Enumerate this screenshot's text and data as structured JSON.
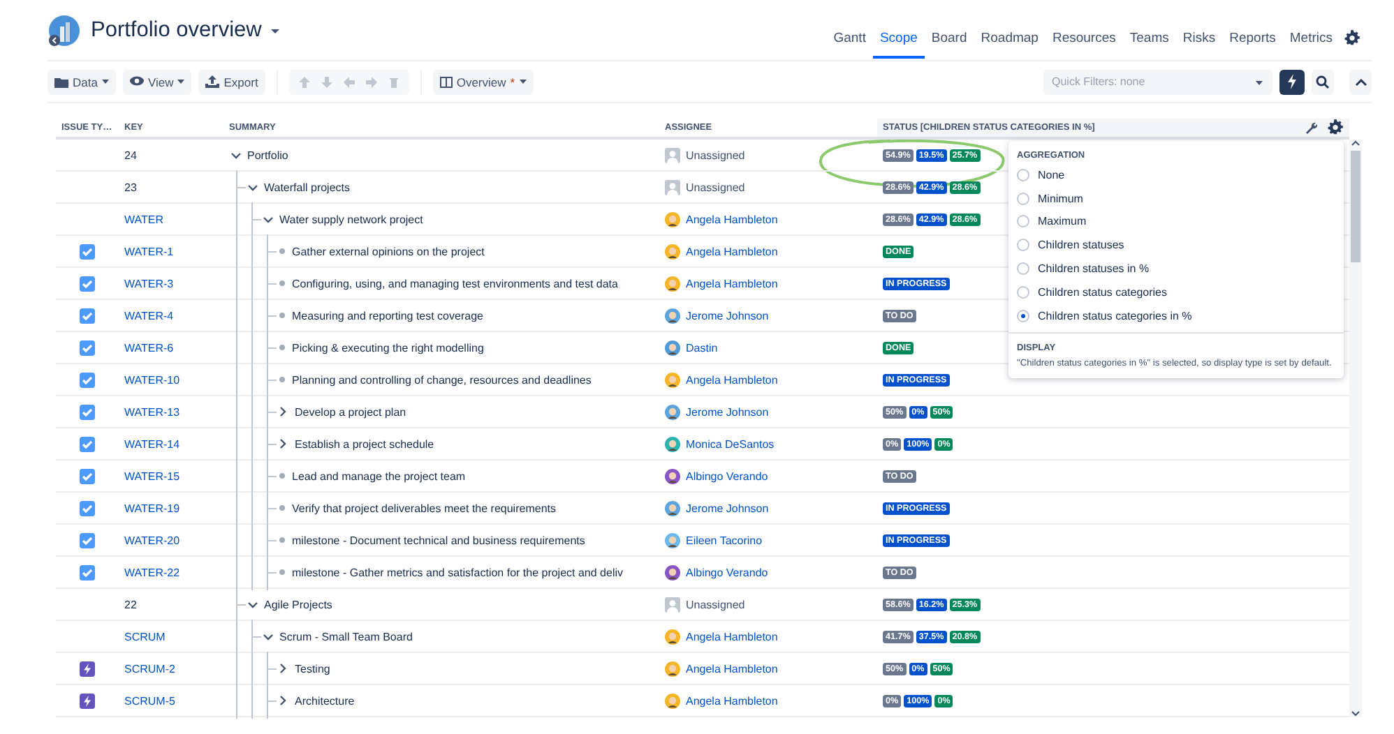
{
  "header": {
    "title": "Portfolio overview",
    "tabs": [
      {
        "label": "Gantt",
        "selected": false
      },
      {
        "label": "Scope",
        "selected": true
      },
      {
        "label": "Board",
        "selected": false
      },
      {
        "label": "Roadmap",
        "selected": false
      },
      {
        "label": "Resources",
        "selected": false
      },
      {
        "label": "Teams",
        "selected": false
      },
      {
        "label": "Risks",
        "selected": false
      },
      {
        "label": "Reports",
        "selected": false
      },
      {
        "label": "Metrics",
        "selected": false
      }
    ]
  },
  "toolbar": {
    "buttons": [
      {
        "label": "Data",
        "kind": "menu"
      },
      {
        "label": "View",
        "kind": "menu"
      },
      {
        "label": "Export",
        "kind": "action"
      }
    ],
    "view": {
      "label": "Overview",
      "modified_mark": "*"
    },
    "quick_filters": {
      "placeholder": "Quick Filters: none"
    }
  },
  "table": {
    "columns": [
      "ISSUE TY…",
      "KEY",
      "SUMMARY",
      "ASSIGNEE",
      "STATUS [CHILDREN STATUS CATEGORIES IN %]"
    ],
    "rows": [
      {
        "key": "24",
        "key_link": false,
        "summary": "Portfolio",
        "expanded": true,
        "assignee": {
          "name": "Unassigned",
          "unassigned": true
        },
        "status": [
          {
            "text": "54.9%",
            "kind": "todo"
          },
          {
            "text": "19.5%",
            "kind": "inprogress"
          },
          {
            "text": "25.7%",
            "kind": "done"
          }
        ],
        "children": [
          {
            "key": "23",
            "key_link": false,
            "summary": "Waterfall projects",
            "expanded": true,
            "assignee": {
              "name": "Unassigned",
              "unassigned": true
            },
            "status": [
              {
                "text": "28.6%",
                "kind": "todo"
              },
              {
                "text": "42.9%",
                "kind": "inprogress"
              },
              {
                "text": "28.6%",
                "kind": "done"
              }
            ],
            "children": [
              {
                "key": "WATER",
                "key_link": true,
                "summary": "Water supply network project",
                "expanded": true,
                "assignee": {
                  "name": "Angela Hambleton",
                  "unassigned": false,
                  "color": "#f4b526"
                },
                "status": [
                  {
                    "text": "28.6%",
                    "kind": "todo"
                  },
                  {
                    "text": "42.9%",
                    "kind": "inprogress"
                  },
                  {
                    "text": "28.6%",
                    "kind": "done"
                  }
                ],
                "children": [
                  {
                    "kind": "task",
                    "key": "WATER-1",
                    "key_link": true,
                    "summary": "Gather external opinions on the project",
                    "assignee": {
                      "name": "Angela Hambleton",
                      "unassigned": false,
                      "color": "#f4b526"
                    },
                    "status": [
                      {
                        "text": "DONE",
                        "kind": "done"
                      }
                    ]
                  },
                  {
                    "kind": "task",
                    "key": "WATER-3",
                    "key_link": true,
                    "summary": "Configuring, using, and managing test environments and test data",
                    "assignee": {
                      "name": "Angela Hambleton",
                      "unassigned": false,
                      "color": "#f4b526"
                    },
                    "status": [
                      {
                        "text": "IN PROGRESS",
                        "kind": "inprogress"
                      }
                    ]
                  },
                  {
                    "kind": "task",
                    "key": "WATER-4",
                    "key_link": true,
                    "summary": "Measuring and reporting test coverage",
                    "assignee": {
                      "name": "Jerome Johnson",
                      "unassigned": false,
                      "color": "#5ba4dd"
                    },
                    "status": [
                      {
                        "text": "TO DO",
                        "kind": "todo"
                      }
                    ]
                  },
                  {
                    "kind": "task",
                    "key": "WATER-6",
                    "key_link": true,
                    "summary": "Picking & executing the right modelling",
                    "assignee": {
                      "name": "Dastin",
                      "unassigned": false,
                      "color": "#4f9bd8"
                    },
                    "status": [
                      {
                        "text": "DONE",
                        "kind": "done"
                      }
                    ]
                  },
                  {
                    "kind": "task",
                    "key": "WATER-10",
                    "key_link": true,
                    "summary": "Planning and controlling of change, resources and deadlines",
                    "assignee": {
                      "name": "Angela Hambleton",
                      "unassigned": false,
                      "color": "#f4b526"
                    },
                    "status": [
                      {
                        "text": "IN PROGRESS",
                        "kind": "inprogress"
                      }
                    ]
                  },
                  {
                    "kind": "task",
                    "key": "WATER-13",
                    "key_link": true,
                    "summary": "Develop a project plan",
                    "expanded": false,
                    "assignee": {
                      "name": "Jerome Johnson",
                      "unassigned": false,
                      "color": "#5ba4dd"
                    },
                    "status": [
                      {
                        "text": "50%",
                        "kind": "todo"
                      },
                      {
                        "text": "0%",
                        "kind": "inprogress"
                      },
                      {
                        "text": "50%",
                        "kind": "done"
                      }
                    ]
                  },
                  {
                    "kind": "task",
                    "key": "WATER-14",
                    "key_link": true,
                    "summary": "Establish a project schedule",
                    "expanded": false,
                    "assignee": {
                      "name": "Monica DeSantos",
                      "unassigned": false,
                      "color": "#2bb5b0"
                    },
                    "status": [
                      {
                        "text": "0%",
                        "kind": "todo"
                      },
                      {
                        "text": "100%",
                        "kind": "inprogress"
                      },
                      {
                        "text": "0%",
                        "kind": "done"
                      }
                    ]
                  },
                  {
                    "kind": "task",
                    "key": "WATER-15",
                    "key_link": true,
                    "summary": "Lead and manage the project team",
                    "assignee": {
                      "name": "Albingo Verando",
                      "unassigned": false,
                      "color": "#8a55c4"
                    },
                    "status": [
                      {
                        "text": "TO DO",
                        "kind": "todo"
                      }
                    ]
                  },
                  {
                    "kind": "task",
                    "key": "WATER-19",
                    "key_link": true,
                    "summary": "Verify that project deliverables meet the requirements",
                    "assignee": {
                      "name": "Jerome Johnson",
                      "unassigned": false,
                      "color": "#5ba4dd"
                    },
                    "status": [
                      {
                        "text": "IN PROGRESS",
                        "kind": "inprogress"
                      }
                    ]
                  },
                  {
                    "kind": "task",
                    "key": "WATER-20",
                    "key_link": true,
                    "summary": "milestone - Document technical and business requirements",
                    "assignee": {
                      "name": "Eileen Tacorino",
                      "unassigned": false,
                      "color": "#6cb8e8"
                    },
                    "status": [
                      {
                        "text": "IN PROGRESS",
                        "kind": "inprogress"
                      }
                    ]
                  },
                  {
                    "kind": "task",
                    "key": "WATER-22",
                    "key_link": true,
                    "summary": "milestone - Gather metrics and satisfaction for the project and deliv",
                    "assignee": {
                      "name": "Albingo Verando",
                      "unassigned": false,
                      "color": "#8a55c4"
                    },
                    "status": [
                      {
                        "text": "TO DO",
                        "kind": "todo"
                      }
                    ]
                  }
                ]
              }
            ]
          },
          {
            "key": "22",
            "key_link": false,
            "summary": "Agile Projects",
            "expanded": true,
            "assignee": {
              "name": "Unassigned",
              "unassigned": true
            },
            "status": [
              {
                "text": "58.6%",
                "kind": "todo"
              },
              {
                "text": "16.2%",
                "kind": "inprogress"
              },
              {
                "text": "25.3%",
                "kind": "done"
              }
            ],
            "children": [
              {
                "key": "SCRUM",
                "key_link": true,
                "summary": "Scrum - Small Team Board",
                "expanded": true,
                "assignee": {
                  "name": "Angela Hambleton",
                  "unassigned": false,
                  "color": "#f4b526"
                },
                "status": [
                  {
                    "text": "41.7%",
                    "kind": "todo"
                  },
                  {
                    "text": "37.5%",
                    "kind": "inprogress"
                  },
                  {
                    "text": "20.8%",
                    "kind": "done"
                  }
                ],
                "children": [
                  {
                    "kind": "epic",
                    "key": "SCRUM-2",
                    "key_link": true,
                    "summary": "Testing",
                    "expanded": false,
                    "assignee": {
                      "name": "Angela Hambleton",
                      "unassigned": false,
                      "color": "#f4b526"
                    },
                    "status": [
                      {
                        "text": "50%",
                        "kind": "todo"
                      },
                      {
                        "text": "0%",
                        "kind": "inprogress"
                      },
                      {
                        "text": "50%",
                        "kind": "done"
                      }
                    ]
                  },
                  {
                    "kind": "epic",
                    "key": "SCRUM-5",
                    "key_link": true,
                    "summary": "Architecture",
                    "expanded": false,
                    "assignee": {
                      "name": "Angela Hambleton",
                      "unassigned": false,
                      "color": "#f4b526"
                    },
                    "status": [
                      {
                        "text": "0%",
                        "kind": "todo"
                      },
                      {
                        "text": "100%",
                        "kind": "inprogress"
                      },
                      {
                        "text": "0%",
                        "kind": "done"
                      }
                    ]
                  }
                ]
              }
            ]
          }
        ]
      }
    ]
  },
  "aggregation_menu": {
    "title": "AGGREGATION",
    "options": [
      {
        "label": "None",
        "selected": false
      },
      {
        "label": "Minimum",
        "selected": false
      },
      {
        "label": "Maximum",
        "selected": false
      },
      {
        "label": "Children statuses",
        "selected": false
      },
      {
        "label": "Children statuses in %",
        "selected": false
      },
      {
        "label": "Children status categories",
        "selected": false
      },
      {
        "label": "Children status categories in %",
        "selected": true
      }
    ],
    "display_title": "DISPLAY",
    "display_note": "\"Children status categories in %\" is selected, so display type is set by default."
  }
}
